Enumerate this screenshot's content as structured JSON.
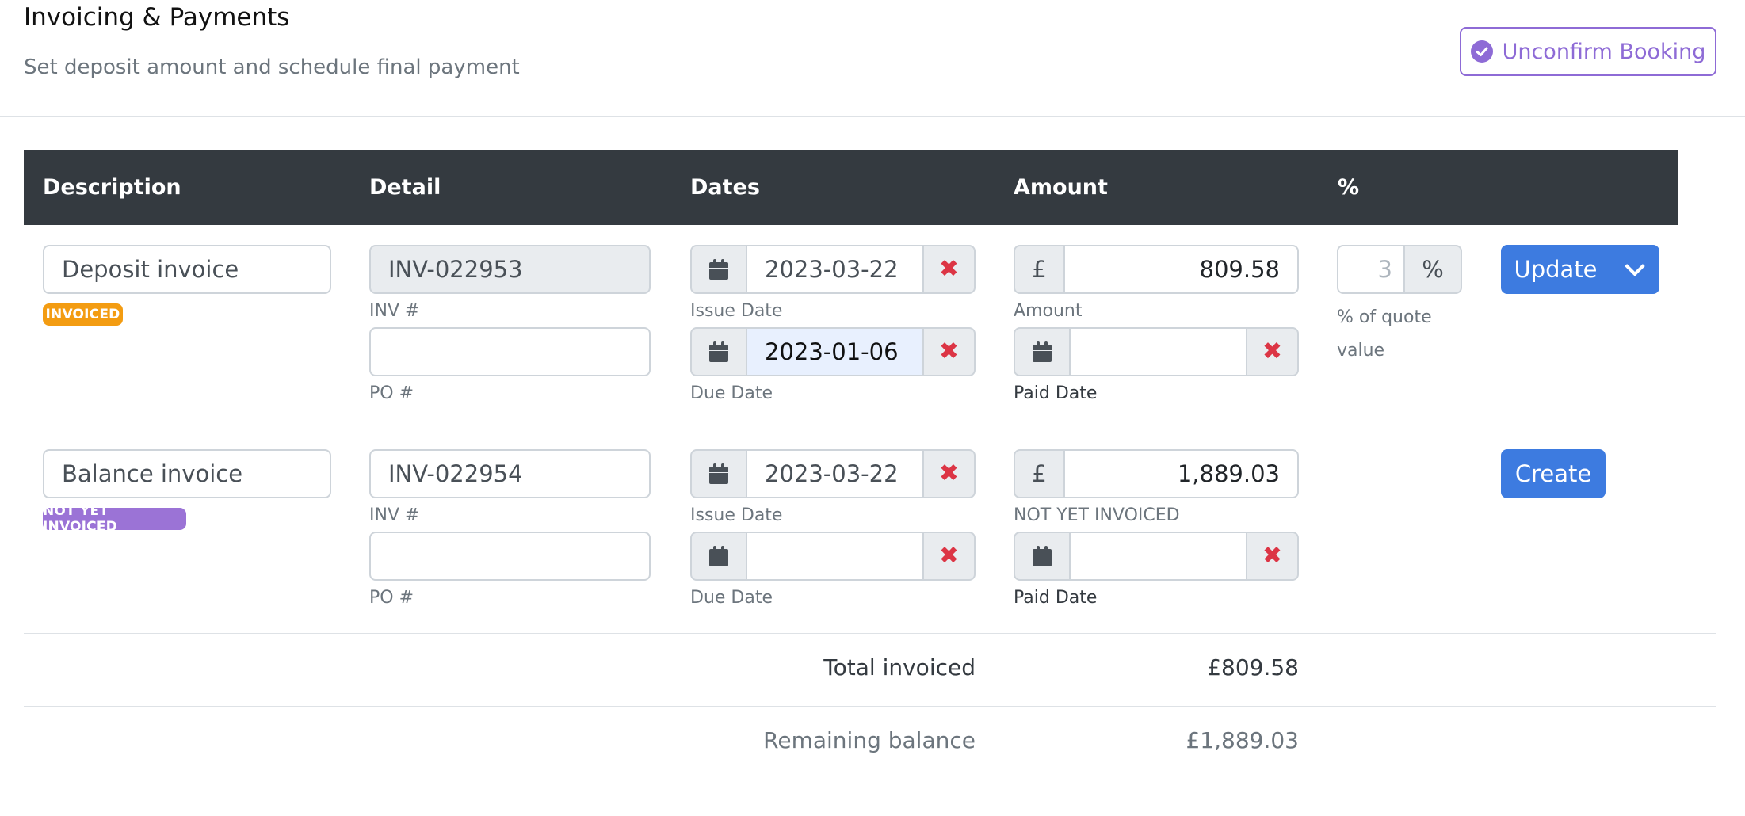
{
  "header": {
    "title": "Invoicing & Payments",
    "subtitle": "Set deposit amount and schedule final payment",
    "unconfirm_label": "Unconfirm Booking"
  },
  "table": {
    "columns": [
      "Description",
      "Detail",
      "Dates",
      "Amount",
      "%"
    ]
  },
  "rows": [
    {
      "description": "Deposit invoice",
      "status_badge": "INVOICED",
      "inv_number": "INV-022953",
      "inv_label": "INV #",
      "po_number": "",
      "po_label": "PO #",
      "issue_date": "2023-03-22",
      "issue_label": "Issue Date",
      "due_date": "2023-01-06",
      "due_label": "Due Date",
      "currency_symbol": "£",
      "amount": "809.58",
      "amount_label": "Amount",
      "paid_date": "",
      "paid_label": "Paid Date",
      "percent_value": "3",
      "percent_symbol": "%",
      "percent_label_line1": "% of quote",
      "percent_label_line2": "value",
      "action_label": "Update"
    },
    {
      "description": "Balance invoice",
      "status_badge": "NOT YET INVOICED",
      "inv_number": "INV-022954",
      "inv_label": "INV #",
      "po_number": "",
      "po_label": "PO #",
      "issue_date": "2023-03-22",
      "issue_label": "Issue Date",
      "due_date": "",
      "due_label": "Due Date",
      "currency_symbol": "£",
      "amount": "1,889.03",
      "amount_label": "NOT YET INVOICED",
      "paid_date": "",
      "paid_label": "Paid Date",
      "action_label": "Create"
    }
  ],
  "summary": {
    "total_invoiced_label": "Total invoiced",
    "total_invoiced_value": "£809.58",
    "remaining_label": "Remaining balance",
    "remaining_value": "£1,889.03"
  },
  "icons": {
    "calendar": "calendar-icon",
    "clear": "clear-x-icon",
    "check": "check-circle-icon",
    "caret": "chevron-down-icon"
  },
  "colors": {
    "header_bg": "#343a40",
    "primary": "#3d7be0",
    "danger": "#dc3545",
    "invoiced_badge": "#f39c12",
    "not_invoiced_badge": "#9b73d6",
    "unconfirm": "#8e6bd6"
  }
}
